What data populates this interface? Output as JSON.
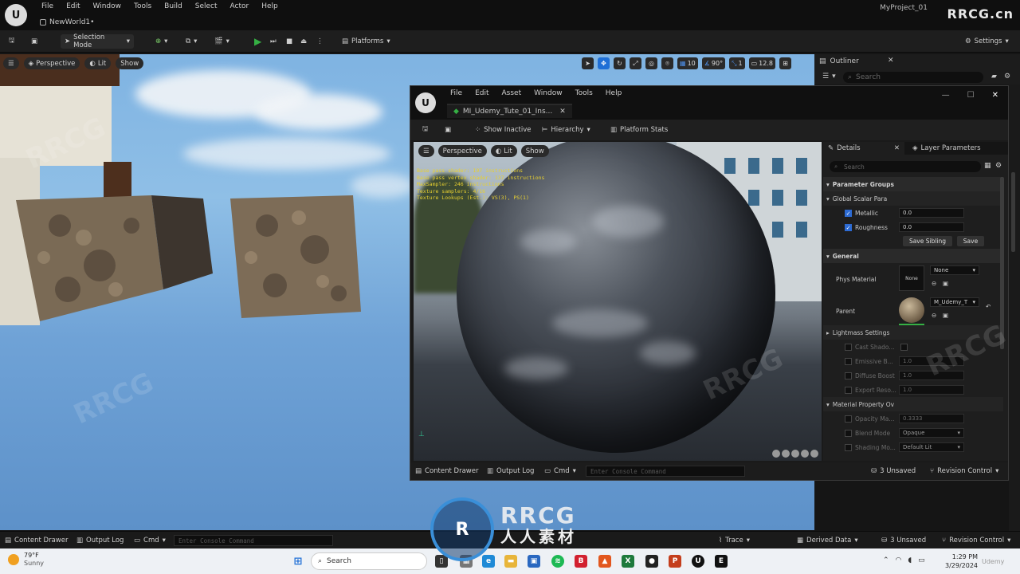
{
  "main": {
    "logo": "U",
    "menu": [
      "File",
      "Edit",
      "Window",
      "Tools",
      "Build",
      "Select",
      "Actor",
      "Help"
    ],
    "level_tab": "NewWorld1•",
    "project": "MyProject_01",
    "toolbar": {
      "selection_mode": "Selection Mode",
      "platforms": "Platforms",
      "settings": "Settings"
    },
    "viewport": {
      "perspective": "Perspective",
      "lit": "Lit",
      "show": "Show",
      "grid_snap": "10",
      "angle_snap": "90°",
      "scale_snap": "1",
      "camera_speed": "12.8"
    },
    "outliner": {
      "title": "Outliner",
      "search_placeholder": "Search"
    },
    "bottom": {
      "content_drawer": "Content Drawer",
      "output_log": "Output Log",
      "cmd": "Cmd",
      "console_placeholder": "Enter Console Command",
      "trace": "Trace",
      "derived_data": "Derived Data",
      "unsaved": "3 Unsaved",
      "revision_control": "Revision Control"
    }
  },
  "material_editor": {
    "logo": "U",
    "menu": [
      "File",
      "Edit",
      "Asset",
      "Window",
      "Tools",
      "Help"
    ],
    "tab": "MI_Udemy_Tute_01_Ins...",
    "toolbar": {
      "show_inactive": "Show Inactive",
      "hierarchy": "Hierarchy",
      "platform_stats": "Platform Stats"
    },
    "viewport": {
      "perspective": "Perspective",
      "lit": "Lit",
      "show": "Show",
      "stats": [
        "Base pass shader: 197 instructions",
        "Base pass vertex shader: 137 instructions",
        "MaxSampler: 246 instructions",
        "Texture samplers: 4/16",
        "Texture Lookups (Est.): VS(3), PS(1)"
      ]
    },
    "details": {
      "tab_details": "Details",
      "tab_layers": "Layer Parameters",
      "search_placeholder": "Search",
      "parameter_groups": "Parameter Groups",
      "global_scalar": "Global Scalar Para",
      "metallic_label": "Metallic",
      "metallic_value": "0.0",
      "roughness_label": "Roughness",
      "roughness_value": "0.0",
      "save_sibling": "Save Sibling",
      "save": "Save",
      "general": "General",
      "phys_material": "Phys Material",
      "phys_none_thumb": "None",
      "phys_none_select": "None",
      "parent": "Parent",
      "parent_value": "M_Udemy_T",
      "lightmass": "Lightmass Settings",
      "cast_shadow": "Cast Shado...",
      "emissive_boost": "Emissive B...",
      "emissive_value": "1.0",
      "diffuse_boost": "Diffuse Boost",
      "diffuse_value": "1.0",
      "export_res": "Export Reso...",
      "export_value": "1.0",
      "material_property": "Material Property Ov",
      "opacity_mask": "Opacity Ma...",
      "opacity_value": "0.3333",
      "blend_mode": "Blend Mode",
      "blend_value": "Opaque",
      "shading_model": "Shading Mo...",
      "shading_value": "Default Lit"
    },
    "bottom": {
      "content_drawer": "Content Drawer",
      "output_log": "Output Log",
      "cmd": "Cmd",
      "console_placeholder": "Enter Console Command",
      "unsaved": "3 Unsaved",
      "revision_control": "Revision Control"
    }
  },
  "taskbar": {
    "temperature": "79°F",
    "weather": "Sunny",
    "search": "Search",
    "time": "1:29 PM",
    "date": "3/29/2024"
  },
  "watermark": {
    "top": "RRCG.cn",
    "logo": "RRCG",
    "subtitle": "人人素材",
    "udemy": "Udemy"
  },
  "colors": {
    "accent_blue": "#1f6fd6",
    "play_green": "#35b044",
    "stats_yellow": "#e8d030"
  }
}
